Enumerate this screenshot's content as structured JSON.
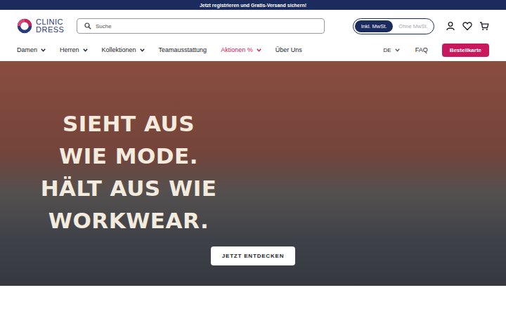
{
  "announcement": "Jetzt registrieren und Gratis-Versand sichern!",
  "logo": {
    "line1": "CLINIC",
    "line2": "DRESS"
  },
  "search": {
    "placeholder": "Suche"
  },
  "tax_toggle": [
    {
      "label": "Inkl. MwSt.",
      "selected": true
    },
    {
      "label": "Ohne MwSt.",
      "selected": false
    }
  ],
  "nav": [
    {
      "label": "Damen",
      "has_dropdown": true,
      "highlighted": false
    },
    {
      "label": "Herren",
      "has_dropdown": true,
      "highlighted": false
    },
    {
      "label": "Kollektionen",
      "has_dropdown": true,
      "highlighted": false
    },
    {
      "label": "Teamausstattung",
      "has_dropdown": false,
      "highlighted": false
    },
    {
      "label": "Aktionen %",
      "has_dropdown": true,
      "highlighted": true
    },
    {
      "label": "Über Uns",
      "has_dropdown": false,
      "highlighted": false
    }
  ],
  "language": {
    "label": "DE",
    "has_dropdown": true
  },
  "faq": "FAQ",
  "order_button": "Bestellkarte",
  "hero": {
    "headline": [
      "SIEHT AUS",
      "WIE MODE.",
      "HÄLT AUS WIE",
      "WORKWEAR."
    ],
    "button": "JETZT ENTDECKEN"
  }
}
